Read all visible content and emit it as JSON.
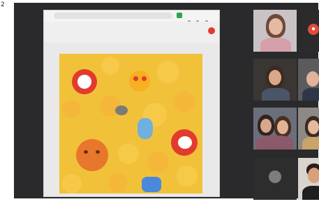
{
  "page": {
    "edge_glyph": "2"
  },
  "browser": {
    "address_text": "",
    "document_title": "",
    "icons": [
      "green-app-icon",
      "record-icon"
    ]
  },
  "shared_image": {
    "subject": "emoji-collage"
  },
  "participants": [
    {
      "id": "p1",
      "name": ""
    },
    {
      "id": "p2",
      "name": "",
      "muted_icon": "●"
    },
    {
      "id": "p3",
      "name": ""
    },
    {
      "id": "p4",
      "name": ""
    },
    {
      "id": "p5",
      "name": ""
    },
    {
      "id": "p6",
      "name": ""
    },
    {
      "id": "p7",
      "name": ""
    },
    {
      "id": "p8",
      "name": ""
    }
  ],
  "colors": {
    "meeting_bg": "#2a2a2c",
    "emoji_yellow": "#f2c13a",
    "heart_red": "#e23b2e",
    "record_red": "#e23b2e"
  }
}
